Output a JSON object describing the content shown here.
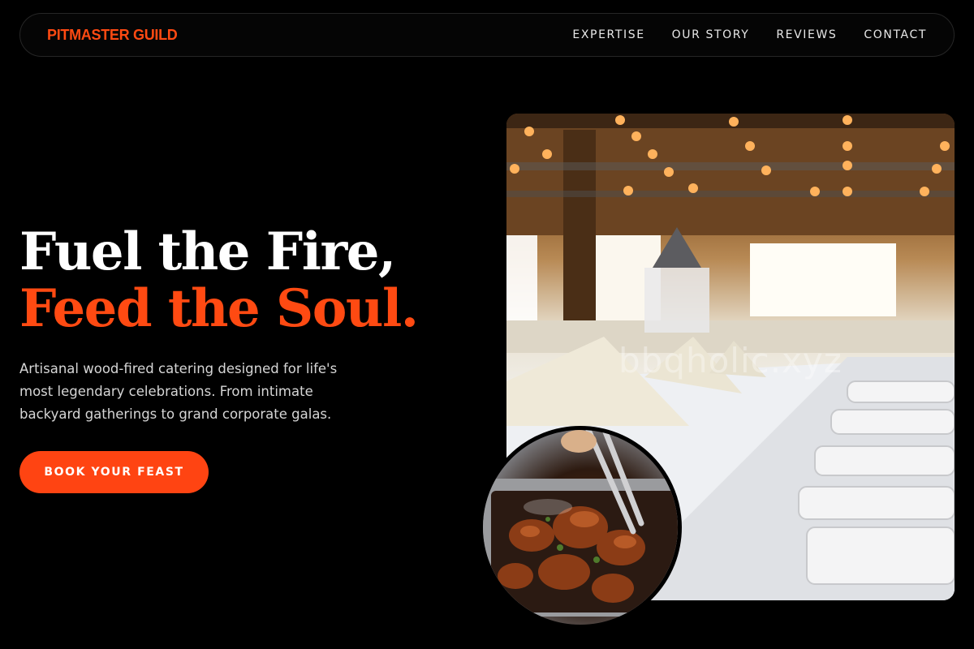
{
  "nav": {
    "brand": "PITMASTER GUILD",
    "links": [
      "EXPERTISE",
      "OUR STORY",
      "REVIEWS",
      "CONTACT"
    ]
  },
  "hero": {
    "headline_line1": "Fuel the Fire,",
    "headline_line2": "Feed the Soul.",
    "subtitle": "Artisanal wood-fired catering designed for life's most legendary celebrations. From intimate backyard gatherings to grand corporate galas.",
    "cta_label": "BOOK YOUR FEAST"
  },
  "images": {
    "main_photo_watermark": "bbqholic.xyz"
  },
  "colors": {
    "accent": "#ff4a12",
    "background": "#000000",
    "text": "#ffffff"
  }
}
